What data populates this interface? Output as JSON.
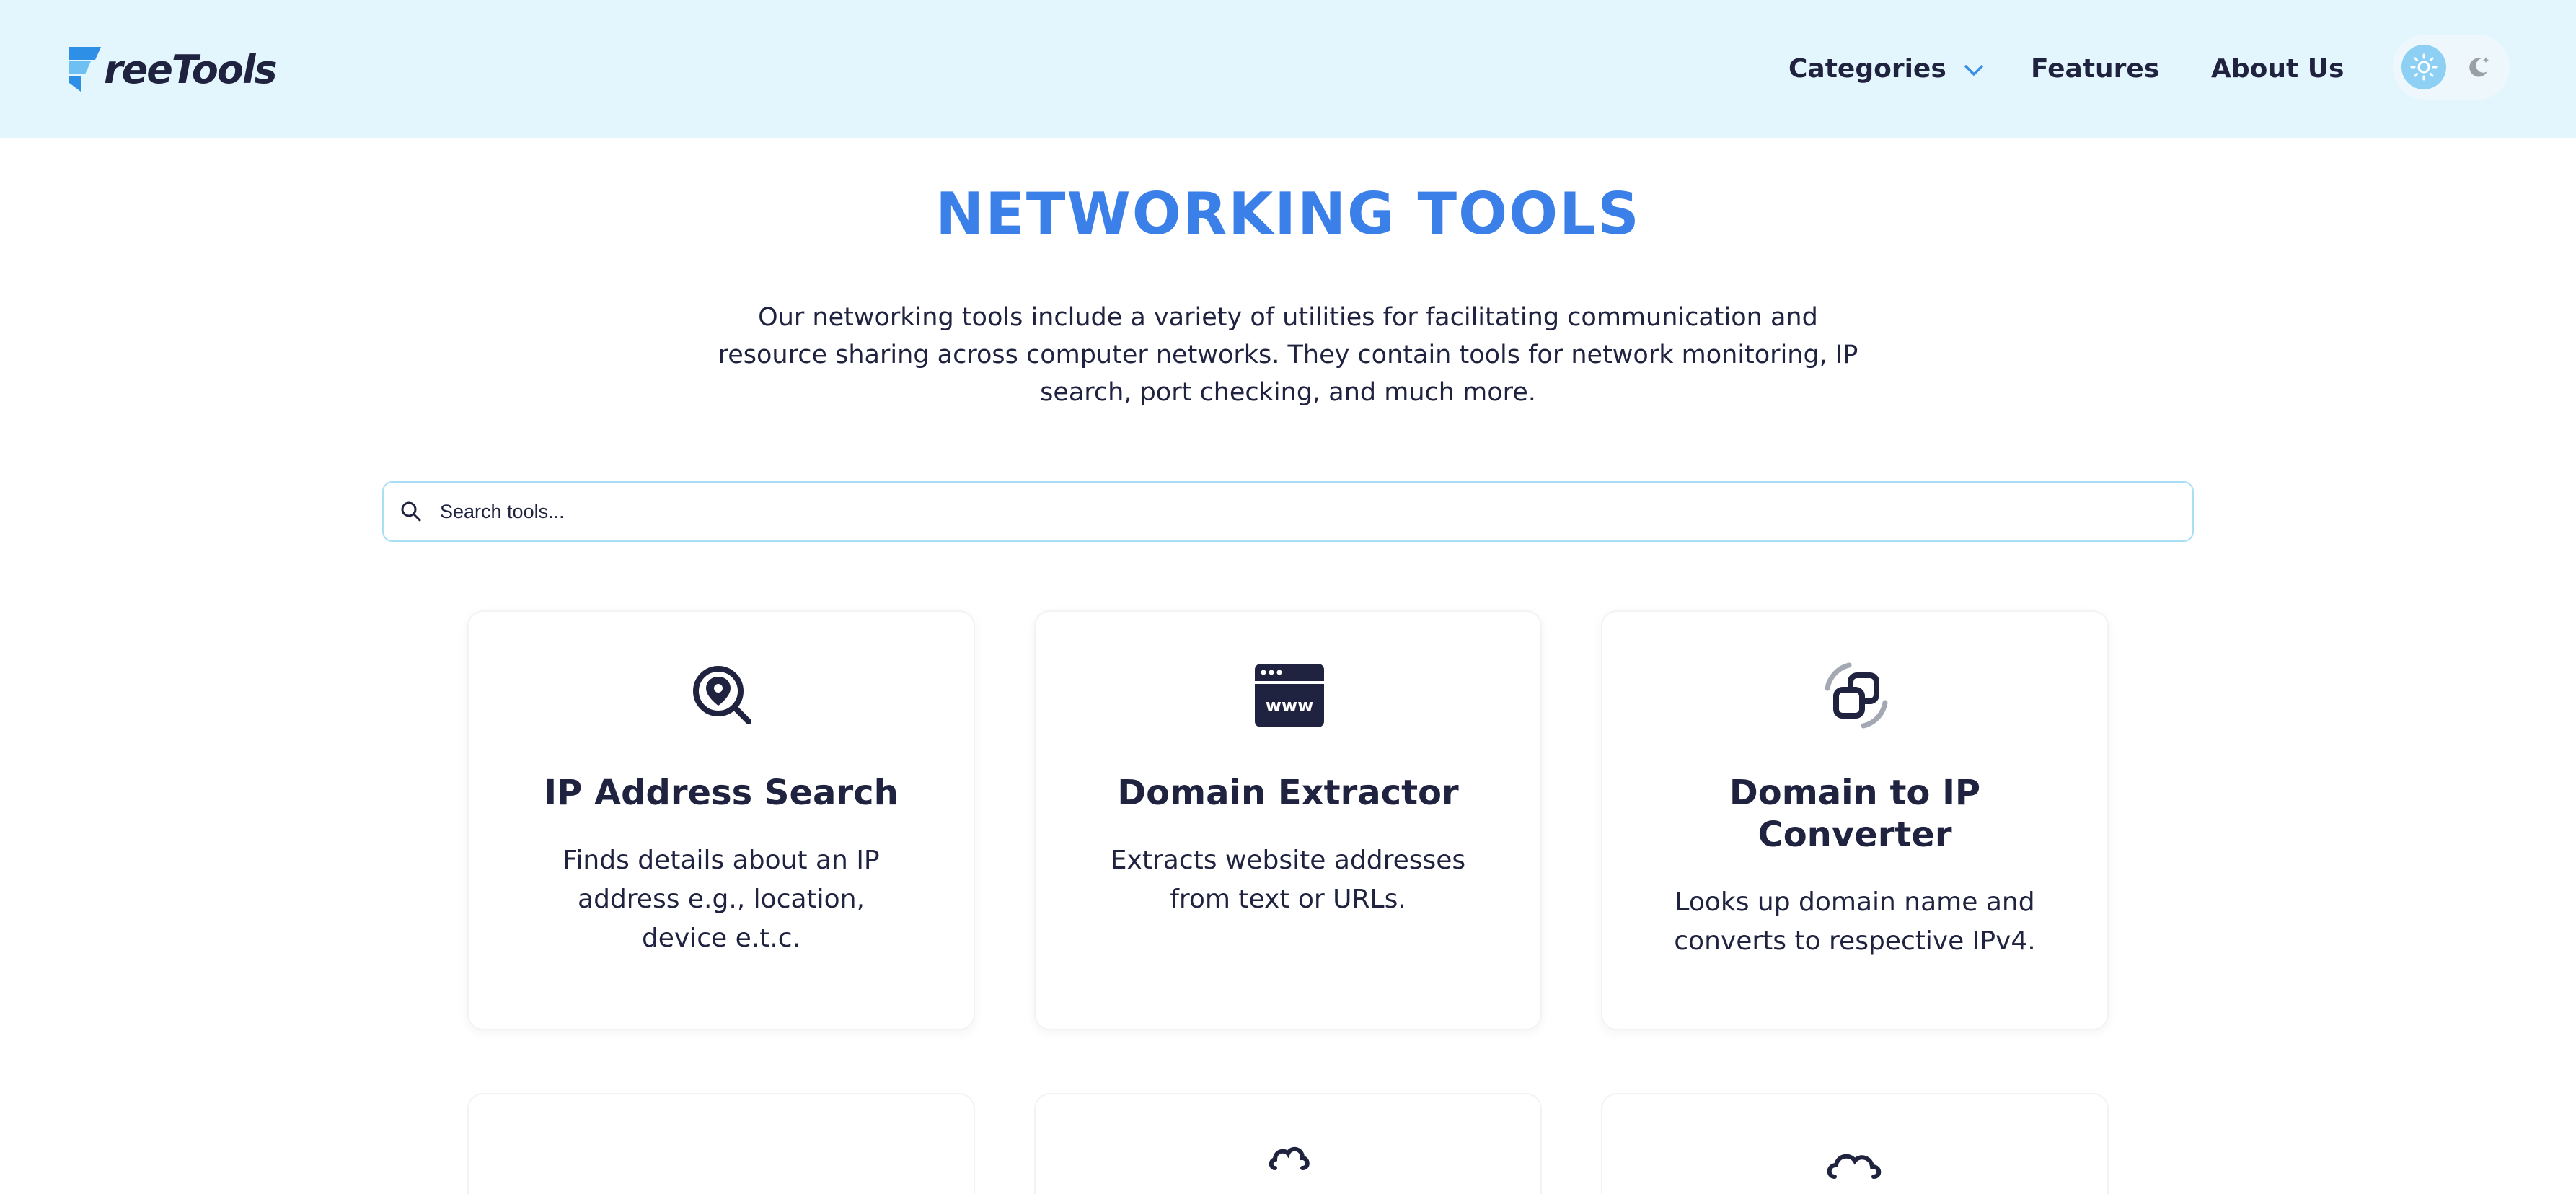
{
  "header": {
    "logo_text": "reeTools",
    "nav": {
      "categories": "Categories",
      "features": "Features",
      "about": "About Us"
    }
  },
  "page": {
    "title": "NETWORKING TOOLS",
    "intro": "Our networking tools include a variety of utilities for facilitating communication and resource sharing across computer networks. They contain tools for network monitoring, IP search, port checking, and much more."
  },
  "search": {
    "placeholder": "Search tools..."
  },
  "tools": [
    {
      "icon": "location-search-icon",
      "title": "IP Address Search",
      "description": "Finds details about an IP address e.g., location, device e.t.c."
    },
    {
      "icon": "browser-www-icon",
      "title": "Domain Extractor",
      "description": "Extracts website addresses from text or URLs."
    },
    {
      "icon": "convert-icon",
      "title": "Domain to IP Converter",
      "description": "Looks up domain name and converts to respective IPv4."
    }
  ],
  "colors": {
    "header_bg": "#e4f6fd",
    "accent": "#3b7fe9",
    "text": "#20233f",
    "search_border": "#a8dff4"
  }
}
